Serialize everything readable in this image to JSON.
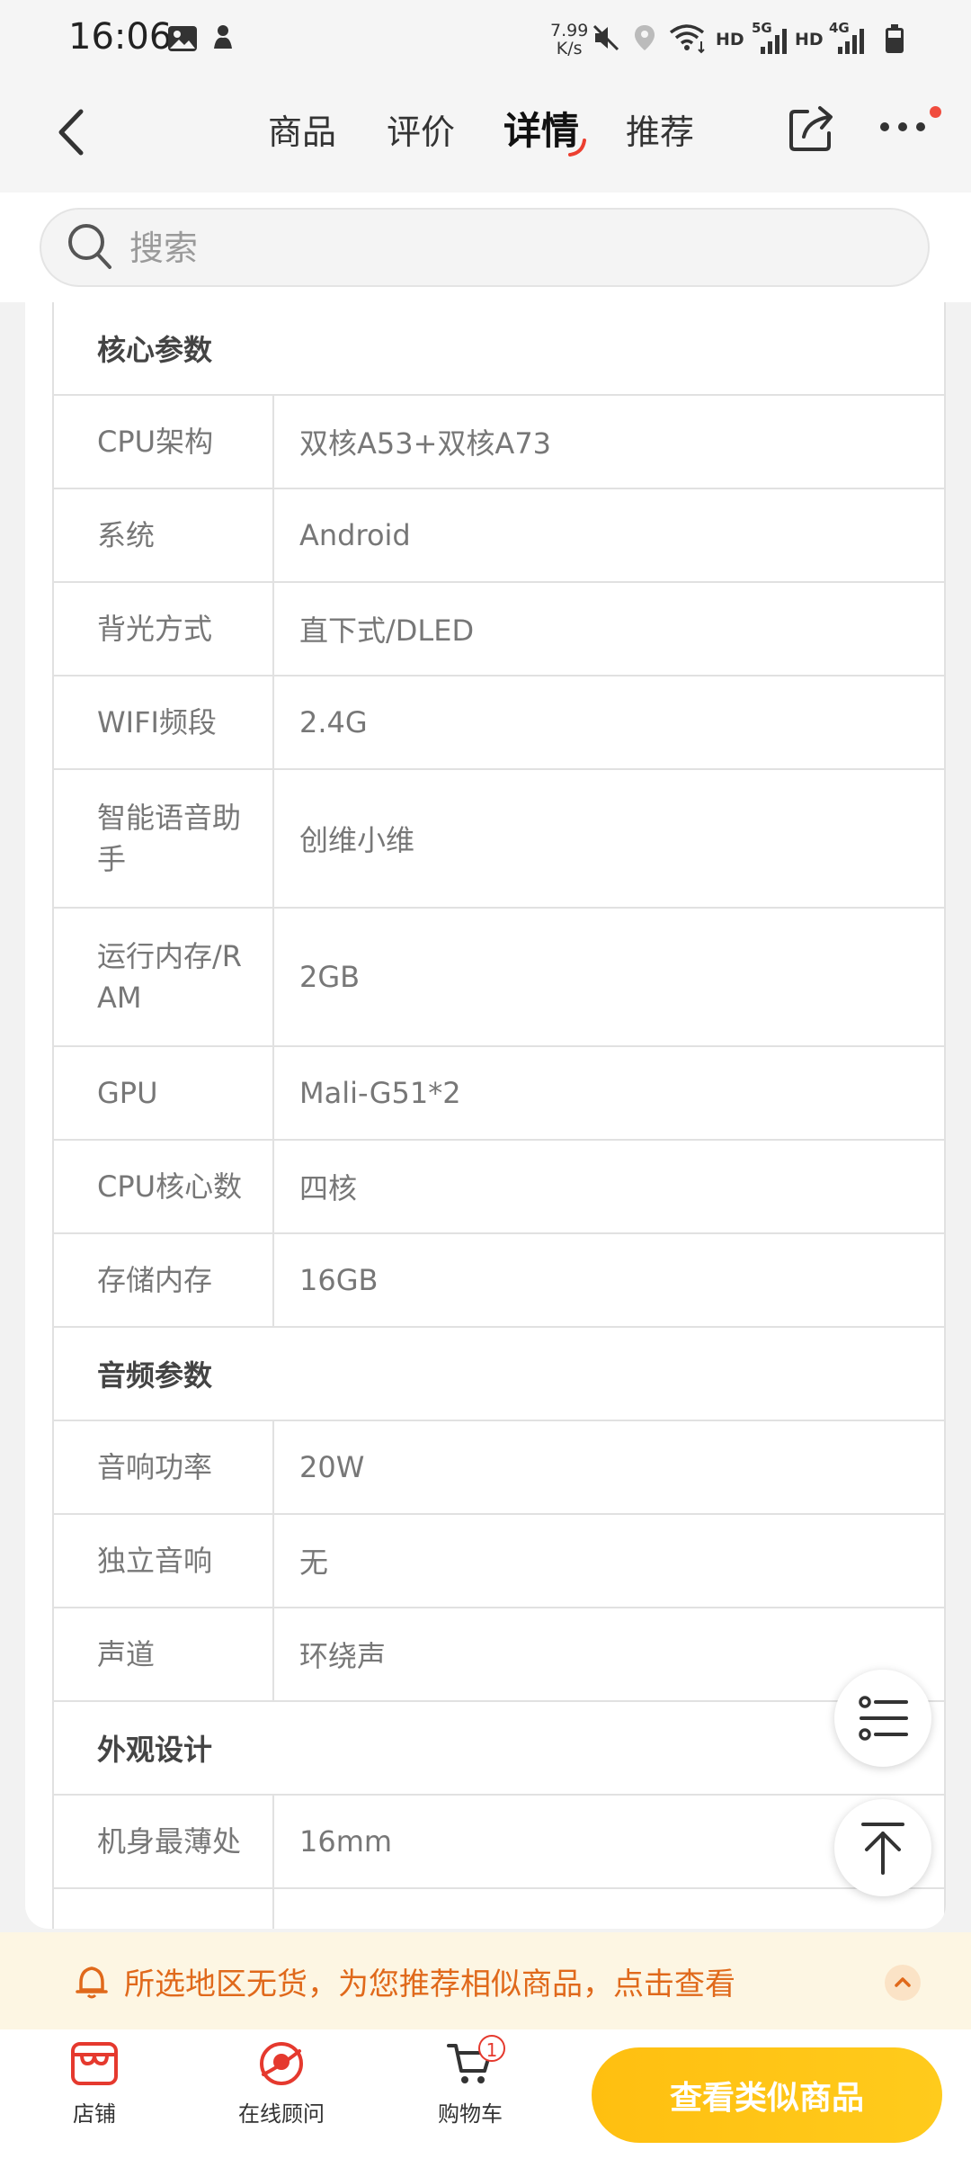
{
  "status_bar": {
    "time": "16:06",
    "net_speed_value": "7.99",
    "net_speed_unit": "K/s",
    "hd1": "HD",
    "hd2": "HD",
    "sig1": "5G",
    "sig2": "4G"
  },
  "nav": {
    "tabs": [
      {
        "label": "商品"
      },
      {
        "label": "评价"
      },
      {
        "label": "详情"
      },
      {
        "label": "推荐"
      }
    ],
    "active_tab": "详情"
  },
  "search": {
    "placeholder": "搜索"
  },
  "spec_table": {
    "sections": [
      {
        "title": "核心参数",
        "rows": [
          {
            "label": "CPU架构",
            "value": "双核A53+双核A73"
          },
          {
            "label": "系统",
            "value": "Android"
          },
          {
            "label": "背光方式",
            "value": "直下式/DLED"
          },
          {
            "label": "WIFI频段",
            "value": "2.4G"
          },
          {
            "label": "智能语音助手",
            "value": "创维小维"
          },
          {
            "label": "运行内存/RAM",
            "value": "2GB"
          },
          {
            "label": "GPU",
            "value": "Mali-G51*2"
          },
          {
            "label": "CPU核心数",
            "value": "四核"
          },
          {
            "label": "存储内存",
            "value": "16GB"
          }
        ]
      },
      {
        "title": "音频参数",
        "rows": [
          {
            "label": "音响功率",
            "value": "20W"
          },
          {
            "label": "独立音响",
            "value": "无"
          },
          {
            "label": "声道",
            "value": "环绕声"
          }
        ]
      },
      {
        "title": "外观设计",
        "rows": [
          {
            "label": "机身最薄处",
            "value": "16mm"
          }
        ]
      }
    ]
  },
  "notice": {
    "text": "所选地区无货，为您推荐相似商品，点击查看"
  },
  "bottom_bar": {
    "store_label": "店铺",
    "advisor_label": "在线顾问",
    "cart_label": "购物车",
    "cart_count": "1",
    "cta_label": "查看类似商品"
  },
  "colors": {
    "accent": "#ffc21a",
    "notice_text": "#e0691b",
    "badge_red": "#e5392e"
  }
}
